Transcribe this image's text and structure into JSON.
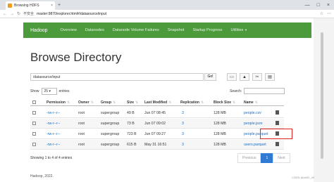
{
  "browser": {
    "tab_title": "Browsing HDFS",
    "tab_close": "×",
    "new_tab": "+",
    "window_controls": [
      "—",
      "□",
      "×"
    ],
    "nav_icons": [
      "←",
      "→",
      "↻"
    ],
    "security": "不安全",
    "url": "master:9870/explorer.html#/datasource/input",
    "toolbar_icons": [
      "☆",
      "⋯"
    ]
  },
  "navbar": {
    "brand": "Hadoop",
    "items": [
      "Overview",
      "Datanodes",
      "Datanode Volume Failures",
      "Snapshot",
      "Startup Progress",
      "Utilities"
    ]
  },
  "page": {
    "title": "Browse Directory",
    "path_value": "/datasource/input",
    "go_label": "Go!",
    "show_label": "Show",
    "entries_count": "25",
    "entries_label": "entries",
    "search_label": "Search:"
  },
  "table": {
    "headers": [
      "Permission",
      "Owner",
      "Group",
      "Size",
      "Last Modified",
      "Replication",
      "Block Size",
      "Name"
    ],
    "rows": [
      {
        "permission": "-rw-r--r--",
        "owner": "root",
        "group": "supergroup",
        "size": "49 B",
        "modified": "Jun 07 08:45",
        "replication": "3",
        "block": "128 MB",
        "name": "people.csv"
      },
      {
        "permission": "-rw-r--r--",
        "owner": "root",
        "group": "supergroup",
        "size": "73 B",
        "modified": "Jun 07 09:02",
        "replication": "3",
        "block": "128 MB",
        "name": "people.json"
      },
      {
        "permission": "-rw-r--r--",
        "owner": "root",
        "group": "supergroup",
        "size": "723 B",
        "modified": "Jun 07 09:27",
        "replication": "3",
        "block": "128 MB",
        "name": "people.parquet"
      },
      {
        "permission": "-rw-r--r--",
        "owner": "root",
        "group": "supergroup",
        "size": "615 B",
        "modified": "May 31 16:51",
        "replication": "3",
        "block": "128 MB",
        "name": "users.parquet"
      }
    ]
  },
  "footer": {
    "showing": "Showing 1 to 4 of 4 entries",
    "previous": "Previous",
    "page": "1",
    "next": "Next",
    "copyright": "Hadoop, 2022.",
    "watermark": "CSDN @dd00_40"
  }
}
